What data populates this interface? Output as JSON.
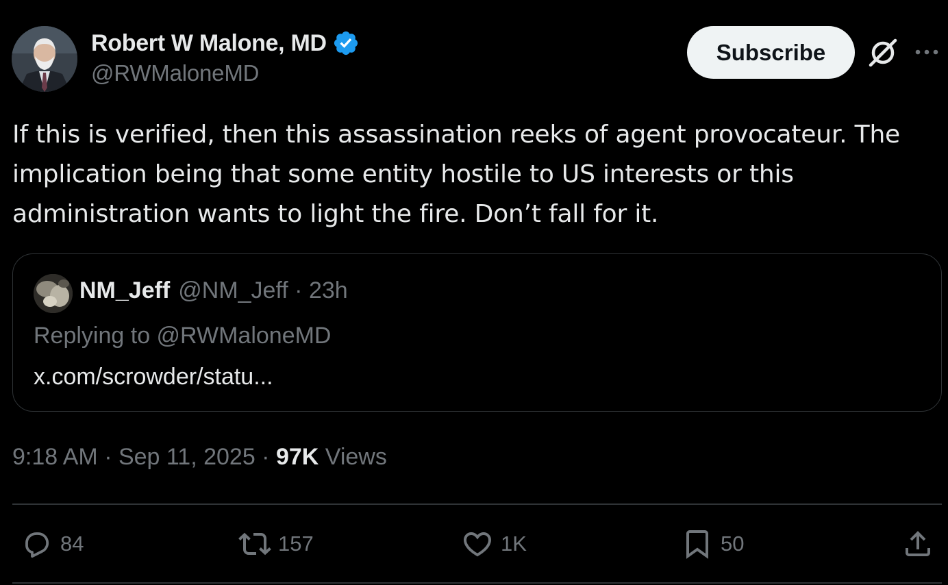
{
  "author": {
    "name": "Robert W Malone, MD",
    "handle": "@RWMaloneMD",
    "verified_color": "#1d9bf0"
  },
  "header": {
    "subscribe_label": "Subscribe",
    "grok_icon": "grok-slash-icon",
    "more_icon": "more-dots-icon"
  },
  "tweet": {
    "text": "If this is verified, then this assassination reeks of agent provocateur.  The\nimplication being that some entity hostile to US interests or this\nadministration wants to light the fire.  Don’t fall for it."
  },
  "quote": {
    "name": "NM_Jeff",
    "meta": "@NM_Jeff · 23h",
    "reply": "Replying to @RWMaloneMD",
    "link": "x.com/scrowder/statu..."
  },
  "meta": {
    "time_date": "9:18 AM · Sep 11, 2025 · ",
    "views_count": "97K",
    "views_label": " Views"
  },
  "actions": {
    "replies": "84",
    "reposts": "157",
    "likes": "1K",
    "bookmarks": "50"
  },
  "colors": {
    "background": "#000000",
    "text_primary": "#e7e9ea",
    "text_secondary": "#71767b",
    "border": "#2f3336",
    "button_bg": "#eff3f4"
  }
}
